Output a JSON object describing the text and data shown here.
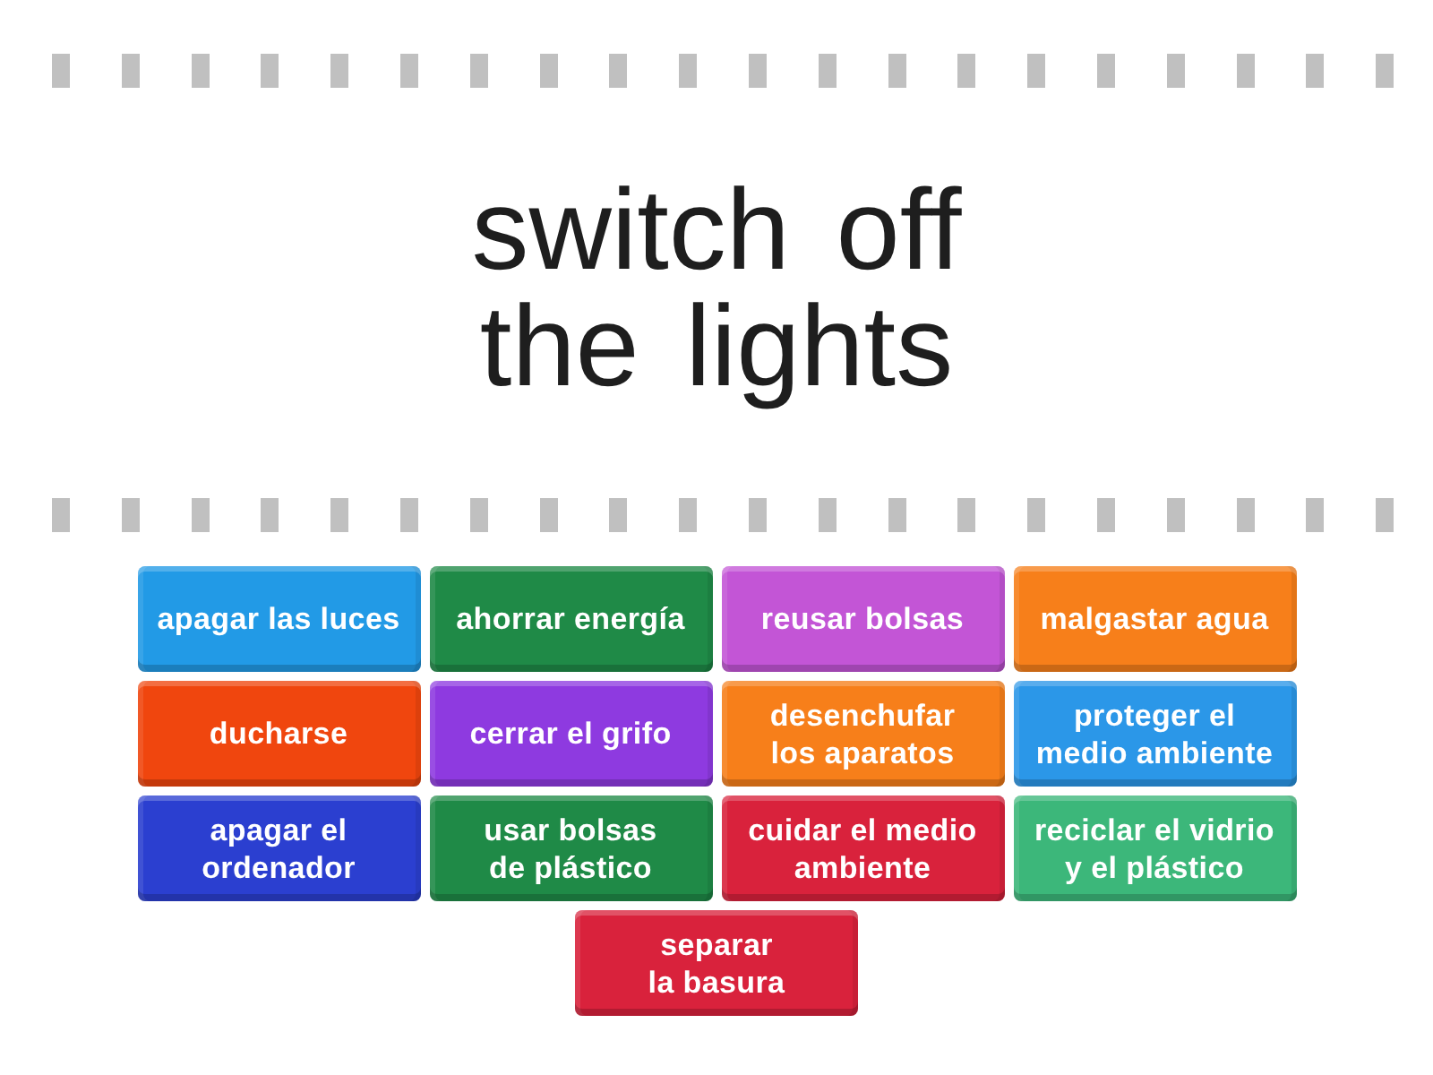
{
  "prompt": {
    "text": "switch off the lights"
  },
  "answers": [
    {
      "label": "apagar las luces",
      "color": "#229ae6"
    },
    {
      "label": "ahorrar energía",
      "color": "#1f8a47"
    },
    {
      "label": "reusar bolsas",
      "color": "#c355d6"
    },
    {
      "label": "malgastar agua",
      "color": "#f77f1a"
    },
    {
      "label": "ducharse",
      "color": "#f0460e"
    },
    {
      "label": "cerrar el grifo",
      "color": "#8e3ae0"
    },
    {
      "label": "desenchufar\nlos aparatos",
      "color": "#f77f1a"
    },
    {
      "label": "proteger el\nmedio ambiente",
      "color": "#2b97e8"
    },
    {
      "label": "apagar el\nordenador",
      "color": "#2b3fd0"
    },
    {
      "label": "usar bolsas\nde plástico",
      "color": "#1f8a47"
    },
    {
      "label": "cuidar el medio\nambiente",
      "color": "#d9223c"
    },
    {
      "label": "reciclar el vidrio\ny el plástico",
      "color": "#3cb77a"
    },
    {
      "label": "separar\nla basura",
      "color": "#d9223c"
    }
  ]
}
